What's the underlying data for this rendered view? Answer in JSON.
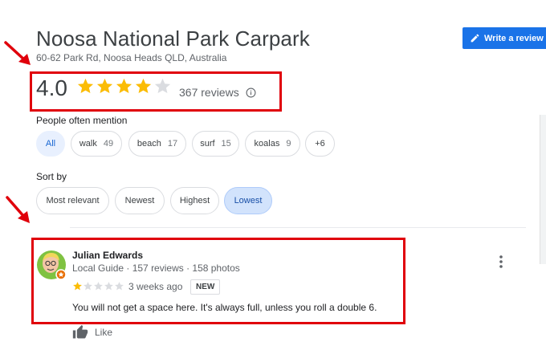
{
  "place": {
    "title": "Noosa National Park Carpark",
    "address": "60-62 Park Rd, Noosa Heads QLD, Australia"
  },
  "actions": {
    "write_review_label": "Write a review",
    "write_review_icon": "pencil-icon"
  },
  "rating": {
    "value": "4.0",
    "stars": 4,
    "max_stars": 5,
    "reviews_label": "367 reviews",
    "info_icon": "info-icon"
  },
  "mentions": {
    "label": "People often mention",
    "chips": [
      {
        "label": "All",
        "count": ""
      },
      {
        "label": "walk",
        "count": "49"
      },
      {
        "label": "beach",
        "count": "17"
      },
      {
        "label": "surf",
        "count": "15"
      },
      {
        "label": "koalas",
        "count": "9"
      },
      {
        "label": "+6",
        "count": ""
      }
    ],
    "selected": "All"
  },
  "sort": {
    "label": "Sort by",
    "options": [
      "Most relevant",
      "Newest",
      "Highest",
      "Lowest"
    ],
    "selected": "Lowest"
  },
  "review": {
    "author": "Julian Edwards",
    "meta": "Local Guide · 157 reviews · 158 photos",
    "stars": 1,
    "time": "3 weeks ago",
    "badge": "NEW",
    "text": "You will not get a space here. It's always full, unless you roll a double 6.",
    "like_label": "Like"
  },
  "colors": {
    "accent": "#1a73e8",
    "star": "#fbbc04",
    "star_empty": "#dadce0",
    "highlight": "#e0000b",
    "selected_chip": "#e8f0fe",
    "selected_sort": "#d2e3fc"
  }
}
